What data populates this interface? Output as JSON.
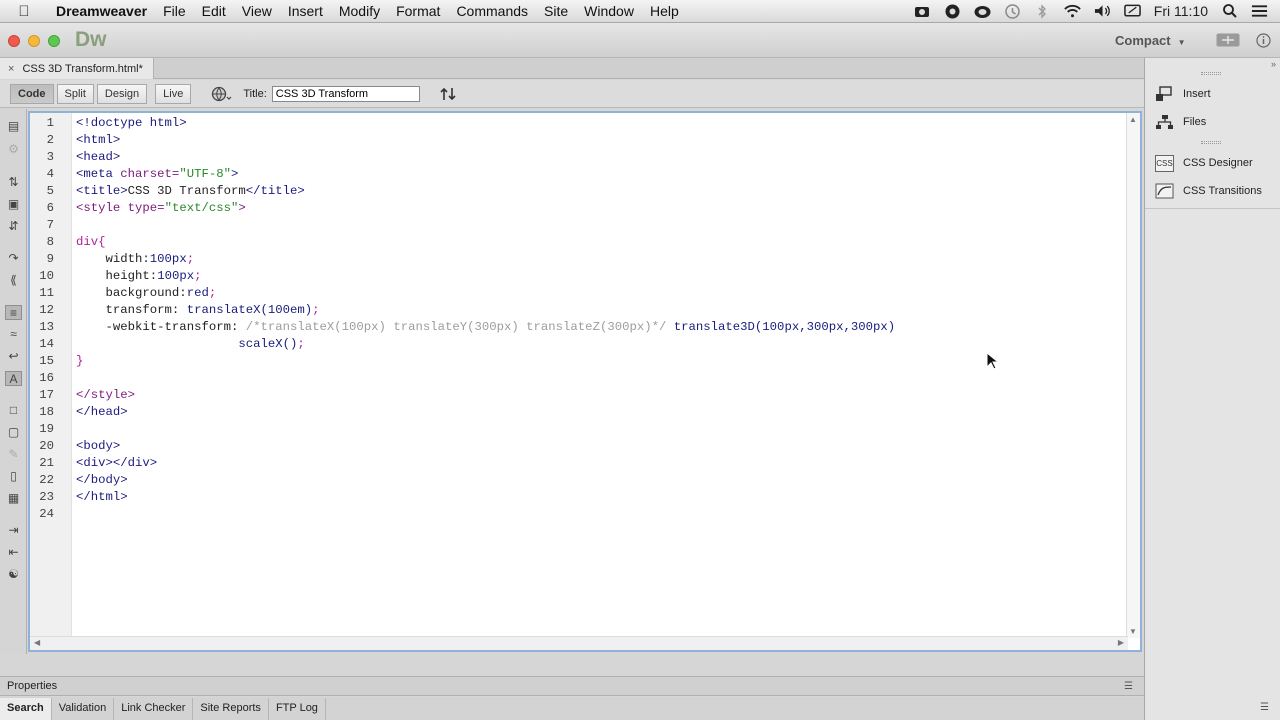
{
  "menubar": {
    "app_name": "Dreamweaver",
    "items": [
      "File",
      "Edit",
      "View",
      "Insert",
      "Modify",
      "Format",
      "Commands",
      "Site",
      "Window",
      "Help"
    ],
    "clock": "Fri 11:10"
  },
  "titlebar": {
    "logo": "Dw",
    "workspace": "Compact"
  },
  "tab": {
    "filename": "CSS 3D Transform.html*"
  },
  "toolbar": {
    "views": [
      "Code",
      "Split",
      "Design",
      "Live"
    ],
    "active_view": "Code",
    "title_label": "Title:",
    "title_value": "CSS 3D Transform"
  },
  "code_lines": [
    {
      "n": "1",
      "tokens": [
        {
          "c": "t-tag",
          "t": "<!doctype html>"
        }
      ]
    },
    {
      "n": "2",
      "tokens": [
        {
          "c": "t-tag",
          "t": "<html>"
        }
      ]
    },
    {
      "n": "3",
      "tokens": [
        {
          "c": "t-tag",
          "t": "<head>"
        }
      ]
    },
    {
      "n": "4",
      "tokens": [
        {
          "c": "t-tag",
          "t": "<meta "
        },
        {
          "c": "t-attr",
          "t": "charset="
        },
        {
          "c": "t-str",
          "t": "\"UTF-8\""
        },
        {
          "c": "t-tag",
          "t": ">"
        }
      ]
    },
    {
      "n": "5",
      "tokens": [
        {
          "c": "t-tag",
          "t": "<title>"
        },
        {
          "c": "t-txt",
          "t": "CSS 3D Transform"
        },
        {
          "c": "t-tag",
          "t": "</title>"
        }
      ]
    },
    {
      "n": "6",
      "tokens": [
        {
          "c": "t-attr",
          "t": "<style "
        },
        {
          "c": "t-attr",
          "t": "type="
        },
        {
          "c": "t-str",
          "t": "\"text/css\""
        },
        {
          "c": "t-attr",
          "t": ">"
        }
      ]
    },
    {
      "n": "7",
      "tokens": []
    },
    {
      "n": "8",
      "tokens": [
        {
          "c": "t-sel",
          "t": "div{"
        }
      ]
    },
    {
      "n": "9",
      "tokens": [
        {
          "c": "t-prop",
          "t": "    width:"
        },
        {
          "c": "t-val",
          "t": "100px"
        },
        {
          "c": "t-sel",
          "t": ";"
        }
      ]
    },
    {
      "n": "10",
      "tokens": [
        {
          "c": "t-prop",
          "t": "    height:"
        },
        {
          "c": "t-val",
          "t": "100px"
        },
        {
          "c": "t-sel",
          "t": ";"
        }
      ]
    },
    {
      "n": "11",
      "tokens": [
        {
          "c": "t-prop",
          "t": "    background:"
        },
        {
          "c": "t-val",
          "t": "red"
        },
        {
          "c": "t-sel",
          "t": ";"
        }
      ]
    },
    {
      "n": "12",
      "tokens": [
        {
          "c": "t-prop",
          "t": "    transform: "
        },
        {
          "c": "t-val",
          "t": "translateX(100em)"
        },
        {
          "c": "t-sel",
          "t": ";"
        }
      ]
    },
    {
      "n": "13",
      "tokens": [
        {
          "c": "t-prop",
          "t": "    -webkit-transform: "
        },
        {
          "c": "t-com",
          "t": "/*translateX(100px) translateY(300px) translateZ(300px)*/ "
        },
        {
          "c": "t-val",
          "t": "translate3D(100px,300px,300px)"
        }
      ]
    },
    {
      "n": "14",
      "tokens": [
        {
          "c": "t-val",
          "t": "                      scaleX()"
        },
        {
          "c": "t-sel",
          "t": ";"
        }
      ]
    },
    {
      "n": "15",
      "tokens": [
        {
          "c": "t-sel",
          "t": "}"
        }
      ]
    },
    {
      "n": "16",
      "tokens": []
    },
    {
      "n": "17",
      "tokens": [
        {
          "c": "t-attr",
          "t": "</style>"
        }
      ]
    },
    {
      "n": "18",
      "tokens": [
        {
          "c": "t-tag",
          "t": "</head>"
        }
      ]
    },
    {
      "n": "19",
      "tokens": []
    },
    {
      "n": "20",
      "tokens": [
        {
          "c": "t-tag",
          "t": "<body>"
        }
      ]
    },
    {
      "n": "21",
      "tokens": [
        {
          "c": "t-tag",
          "t": "<div></div>"
        }
      ]
    },
    {
      "n": "22",
      "tokens": [
        {
          "c": "t-tag",
          "t": "</body>"
        }
      ]
    },
    {
      "n": "23",
      "tokens": [
        {
          "c": "t-tag",
          "t": "</html>"
        }
      ]
    },
    {
      "n": "24",
      "tokens": []
    }
  ],
  "right_panel": {
    "items": [
      {
        "label": "Insert",
        "icon": "insert-icon"
      },
      {
        "label": "Files",
        "icon": "files-icon"
      },
      {
        "label": "CSS Designer",
        "icon": "css-designer-icon"
      },
      {
        "label": "CSS Transitions",
        "icon": "css-transitions-icon"
      }
    ]
  },
  "properties": {
    "label": "Properties"
  },
  "bottom_tabs": [
    "Search",
    "Validation",
    "Link Checker",
    "Site Reports",
    "FTP Log"
  ],
  "active_bottom_tab": "Search",
  "colors": {
    "accent_border": "#8fb2d8",
    "close_light": "#ee5b4f",
    "min_light": "#f5b83b",
    "max_light": "#5fc653"
  }
}
